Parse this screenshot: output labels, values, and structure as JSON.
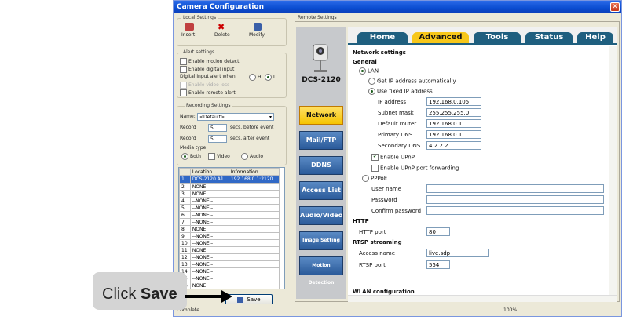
{
  "window": {
    "title": "Camera Configuration",
    "close": "✕"
  },
  "local": {
    "group_label": "Local Settings",
    "insert": "Insert",
    "delete": "Delete",
    "modify": "Modify",
    "alert_group": "Alert settings",
    "motion_detect": "Enable motion detect",
    "digital_input": "Enable digital input",
    "digital_input_when": "Digital input alert when",
    "dil_h": "H",
    "dil_l": "L",
    "video_loss": "Enable video loss",
    "remote_alert": "Enable remote alert",
    "recording_group": "Recording Settings",
    "name_label": "Name:",
    "name_value": "<Default>",
    "record1_label": "Record",
    "record1_value": "5",
    "record1_unit": "secs. before event",
    "record2_label": "Record",
    "record2_value": "5",
    "record2_unit": "secs. after event",
    "media_label": "Media type:",
    "media_both": "Both",
    "media_video": "Video",
    "media_audio": "Audio",
    "table_headers": [
      "",
      "Location",
      "Information"
    ],
    "table_rows": [
      [
        "1",
        "DCS-2120 A1",
        "192.168.0.1:2120"
      ],
      [
        "2",
        "NONE",
        ""
      ],
      [
        "3",
        "NONE",
        ""
      ],
      [
        "4",
        "--NONE--",
        ""
      ],
      [
        "5",
        "--NONE--",
        ""
      ],
      [
        "6",
        "--NONE--",
        ""
      ],
      [
        "7",
        "--NONE--",
        ""
      ],
      [
        "8",
        "NONE",
        ""
      ],
      [
        "9",
        "--NONE--",
        ""
      ],
      [
        "10",
        "--NONE--",
        ""
      ],
      [
        "11",
        "NONE",
        ""
      ],
      [
        "12",
        "--NONE--",
        ""
      ],
      [
        "13",
        "--NONE--",
        ""
      ],
      [
        "14",
        "--NONE--",
        ""
      ],
      [
        "15",
        "--NONE--",
        ""
      ],
      [
        "16",
        "NONE",
        ""
      ]
    ],
    "save": "Save"
  },
  "remote": {
    "label": "Remote Settings",
    "model": "DCS-2120",
    "nav": [
      "Network",
      "Mail/FTP",
      "DDNS",
      "Access List",
      "Audio/Video",
      "Image Setting",
      "Motion Detection"
    ],
    "tabs": [
      "Home",
      "Advanced",
      "Tools",
      "Status",
      "Help"
    ],
    "active_tab": "Advanced"
  },
  "network": {
    "title": "Network settings",
    "general": "General",
    "lan": "LAN",
    "get_ip": "Get IP address automatically",
    "use_fixed": "Use fixed IP address",
    "ip_label": "IP address",
    "ip_value": "192.168.0.105",
    "mask_label": "Subnet mask",
    "mask_value": "255.255.255.0",
    "router_label": "Default router",
    "router_value": "192.168.0.1",
    "dns1_label": "Primary DNS",
    "dns1_value": "192.168.0.1",
    "dns2_label": "Secondary DNS",
    "dns2_value": "4.2.2.2",
    "upnp": "Enable UPnP",
    "upnp_fwd": "Enable UPnP port forwarding",
    "pppoe": "PPPoE",
    "user_label": "User name",
    "pass_label": "Password",
    "confirm_label": "Confirm password",
    "http": "HTTP",
    "http_port_label": "HTTP port",
    "http_port_value": "80",
    "rtsp": "RTSP streaming",
    "access_label": "Access name",
    "access_value": "live.sdp",
    "rtsp_port_label": "RTSP port",
    "rtsp_port_value": "554",
    "wlan": "WLAN configuration"
  },
  "status": {
    "left": "Complete",
    "zoom": "100%"
  },
  "callout": {
    "click": "Click",
    "save": "Save"
  }
}
